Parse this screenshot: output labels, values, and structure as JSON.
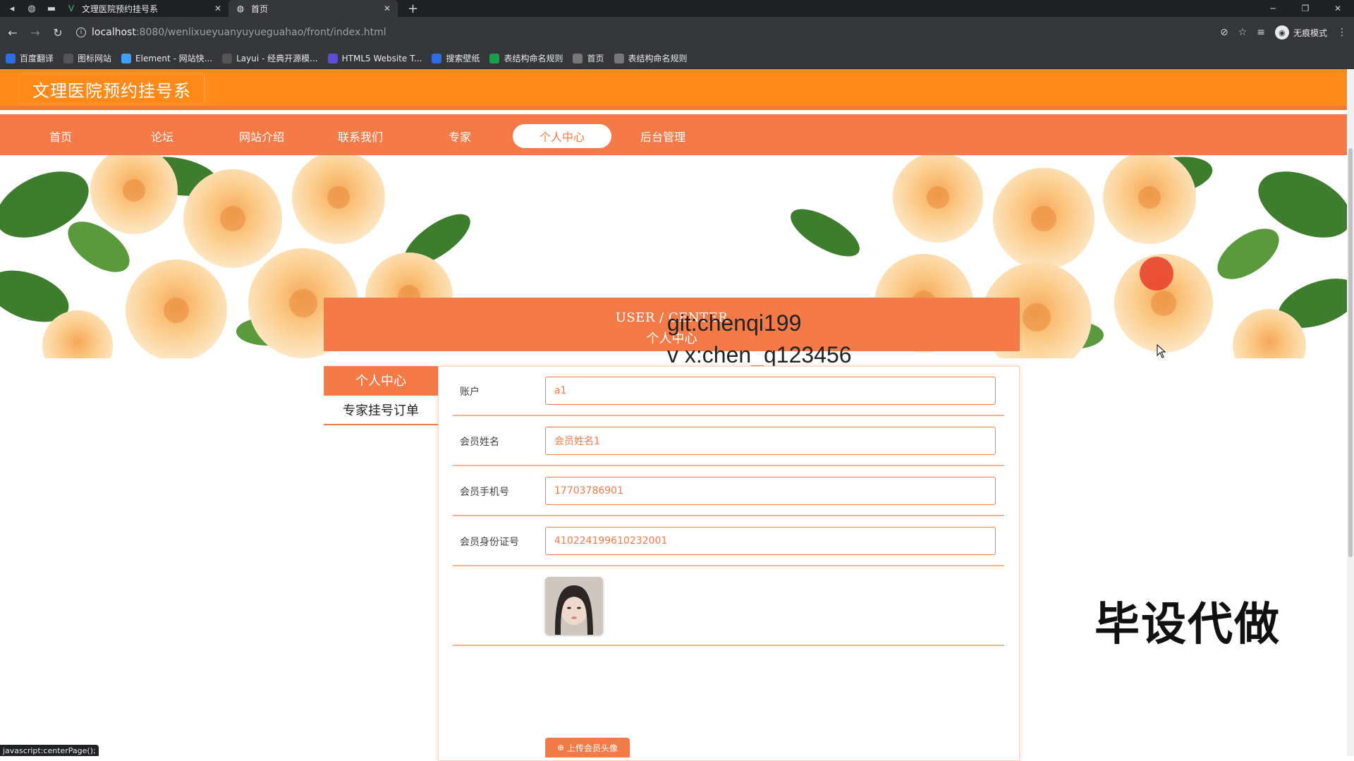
{
  "browser": {
    "tabs": [
      {
        "title": "文理医院预约挂号系",
        "active": false
      },
      {
        "title": "首页",
        "active": true
      }
    ],
    "url_host": "localhost",
    "url_path": ":8080/wenlixueyuanyuyueguahao/front/index.html",
    "profile_label": "无痕模式",
    "bookmarks": [
      {
        "label": "百度翻译",
        "icon": "baidu-translate-icon",
        "color": "#2b6de5"
      },
      {
        "label": "图标网站",
        "icon": "flag-icon",
        "color": "#555555"
      },
      {
        "label": "Element - 网站快...",
        "icon": "element-icon",
        "color": "#409eff"
      },
      {
        "label": "Layui - 经典开源模...",
        "icon": "layui-icon",
        "color": "#555555"
      },
      {
        "label": "HTML5 Website T...",
        "icon": "html5-icon",
        "color": "#5b4fd6"
      },
      {
        "label": "搜索壁纸",
        "icon": "wallpaper-icon",
        "color": "#2b6de5"
      },
      {
        "label": "表结构命名规则",
        "icon": "sheet-icon",
        "color": "#1a9f4a"
      },
      {
        "label": "首页",
        "icon": "globe-icon",
        "color": "#777777"
      },
      {
        "label": "表结构命名规则",
        "icon": "globe-icon",
        "color": "#777777"
      }
    ],
    "status_text": "javascript:centerPage();"
  },
  "site": {
    "title": "文理医院预约挂号系",
    "nav": [
      {
        "label": "首页",
        "active": false
      },
      {
        "label": "论坛",
        "active": false
      },
      {
        "label": "网站介绍",
        "active": false
      },
      {
        "label": "联系我们",
        "active": false
      },
      {
        "label": "专家",
        "active": false
      },
      {
        "label": "个人中心",
        "active": true
      },
      {
        "label": "后台管理",
        "active": false
      }
    ],
    "colors": {
      "header": "#ff8a1a",
      "nav": "#f57a48",
      "accent": "#f47a48"
    }
  },
  "banner": {
    "slides": 3,
    "active_slide": 1
  },
  "user_center": {
    "title_en": "USER / CENTER",
    "title_cn": "个人中心",
    "side_menu": [
      {
        "label": "个人中心",
        "active": true
      },
      {
        "label": "专家挂号订单",
        "active": false
      }
    ],
    "form": {
      "account_label": "账户",
      "account_value": "a1",
      "name_label": "会员姓名",
      "name_value": "会员姓名1",
      "phone_label": "会员手机号",
      "phone_value": "17703786901",
      "id_label": "会员身份证号",
      "id_value": "410224199610232001",
      "upload_label": "上传会员头像"
    }
  },
  "overlays": {
    "watermark_1": "git:chenqi199",
    "watermark_2": "v x:chen_q123456",
    "promo": "毕设代做"
  }
}
